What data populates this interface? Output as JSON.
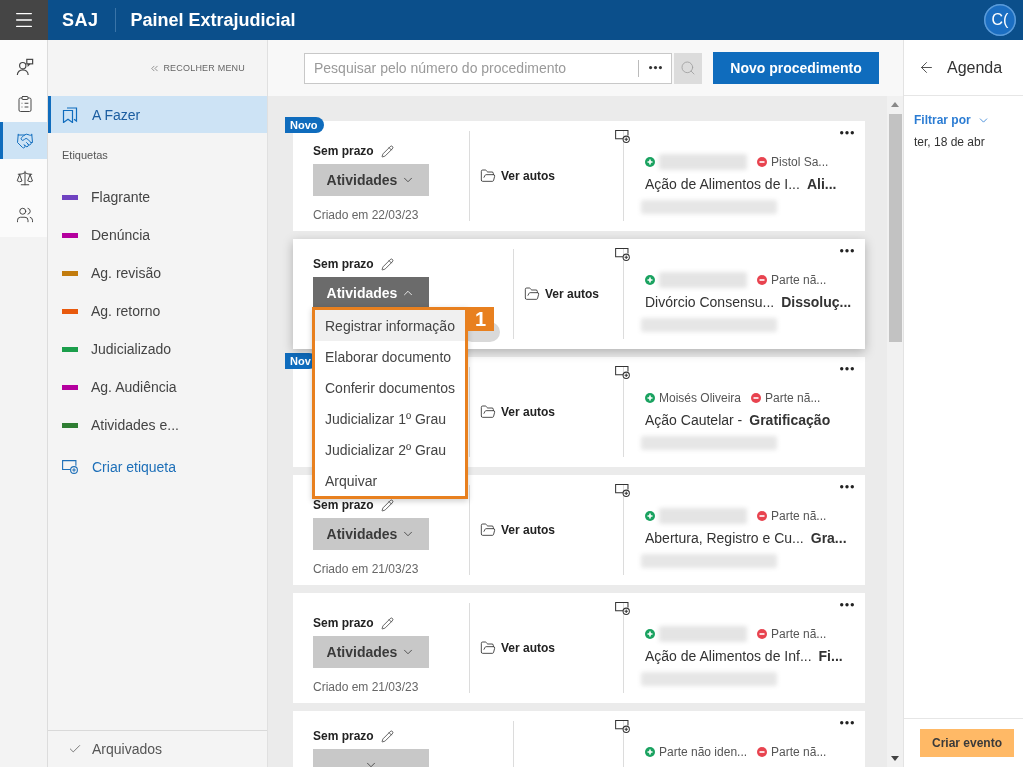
{
  "header": {
    "logo": "SAJ",
    "title": "Painel Extrajudicial",
    "avatar": "C("
  },
  "rail": [
    {
      "kind": "person-message",
      "selected": false
    },
    {
      "kind": "clipboard",
      "selected": false
    },
    {
      "kind": "handshake",
      "selected": true
    },
    {
      "kind": "scales",
      "selected": false
    },
    {
      "kind": "people",
      "selected": false
    }
  ],
  "sidebar": {
    "collapse_label": "RECOLHER MENU",
    "nav": [
      {
        "label": "A Fazer",
        "selected": true
      }
    ],
    "tags_heading": "Etiquetas",
    "tags": [
      {
        "label": "Flagrante",
        "color": "#6f42c1"
      },
      {
        "label": "Denúncia",
        "color": "#b4009e"
      },
      {
        "label": "Ag. revisão",
        "color": "#c27c0e"
      },
      {
        "label": "Ag. retorno",
        "color": "#e8590c"
      },
      {
        "label": "Judicializado",
        "color": "#1b9e4b"
      },
      {
        "label": "Ag. Audiência",
        "color": "#b4009e"
      },
      {
        "label": "Atividades e...",
        "color": "#2e7d32"
      }
    ],
    "create_tag": "Criar etiqueta",
    "footer": "Arquivados"
  },
  "toolbar": {
    "search": {
      "placeholder": "Pesquisar pelo número do procedimento"
    },
    "new_button": "Novo procedimento"
  },
  "cards": [
    {
      "kind": "standard",
      "badge": "Novo",
      "deadline": "Sem prazo",
      "activities": {
        "label": "Atividades",
        "expanded": false
      },
      "created": "Criado em 22/03/23",
      "link": "Ver autos",
      "parties": [
        {
          "kind": "plaintiff",
          "redacted": true
        },
        {
          "kind": "defendant",
          "name": "Pistol Sa..."
        }
      ],
      "title": "Ação de Alimentos de I...",
      "subject": "Ali...",
      "detail_redacted": true
    },
    {
      "kind": "tracked",
      "deadline": "Sem prazo",
      "activities": {
        "label": "Atividades",
        "expanded": true
      },
      "counter_badge": true,
      "link": "Ver autos",
      "parties": [
        {
          "kind": "plaintiff",
          "redacted": true
        },
        {
          "kind": "defendant",
          "name": "Parte nã..."
        }
      ],
      "title": "Divórcio Consensu...",
      "subject": "Dissoluç...",
      "detail_redacted": true
    },
    {
      "kind": "standard",
      "badge": "Nov",
      "link": "Ver autos",
      "parties": [
        {
          "kind": "plaintiff",
          "name": "Moisés Oliveira"
        },
        {
          "kind": "defendant",
          "name": "Parte nã..."
        }
      ],
      "title": "Ação Cautelar -",
      "subject": "Gratificação",
      "detail_redacted": true
    },
    {
      "kind": "standard",
      "deadline": "Sem prazo",
      "activities": {
        "label": "Atividades",
        "expanded": false
      },
      "created": "Criado em 21/03/23",
      "link": "Ver autos",
      "parties": [
        {
          "kind": "plaintiff",
          "redacted": true
        },
        {
          "kind": "defendant",
          "name": "Parte nã..."
        }
      ],
      "title": "Abertura, Registro e Cu...",
      "subject": "Gra...",
      "detail_redacted": true
    },
    {
      "kind": "standard",
      "deadline": "Sem prazo",
      "activities": {
        "label": "Atividades",
        "expanded": false
      },
      "created": "Criado em 21/03/23",
      "link": "Ver autos",
      "parties": [
        {
          "kind": "plaintiff",
          "redacted": true
        },
        {
          "kind": "defendant",
          "name": "Parte nã..."
        }
      ],
      "title": "Ação de Alimentos de Inf...",
      "subject": "Fi...",
      "detail_redacted": true
    },
    {
      "kind": "tracked",
      "deadline": "Sem prazo",
      "activities": {
        "expanded": false
      },
      "parties": [
        {
          "kind": "plaintiff",
          "name": "Parte não iden..."
        },
        {
          "kind": "defendant",
          "name": "Parte nã..."
        }
      ]
    }
  ],
  "activities_menu": {
    "items": [
      {
        "label": "Registrar informação",
        "selected": true
      },
      {
        "label": "Elaborar documento",
        "selected": false
      },
      {
        "label": "Conferir documentos",
        "selected": false
      },
      {
        "label": "Judicializar 1º Grau",
        "selected": false
      },
      {
        "label": "Judicializar 2º Grau",
        "selected": false
      },
      {
        "label": "Arquivar",
        "selected": false
      }
    ],
    "step": "1"
  },
  "agenda": {
    "title": "Agenda",
    "filter": "Filtrar por",
    "date": "ter, 18 de abr",
    "create_button": "Criar evento"
  }
}
